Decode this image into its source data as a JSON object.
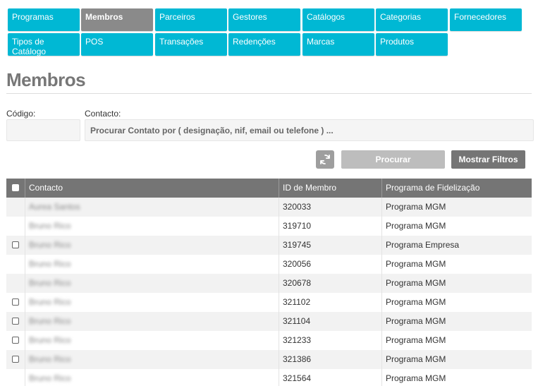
{
  "nav": {
    "row1": [
      "Programas",
      "Membros",
      "Parceiros",
      "Gestores",
      "Catálogos",
      "Categorias",
      "Fornecedores"
    ],
    "row2": [
      "Tipos de Catálogo",
      "POS",
      "Transações",
      "Redenções",
      "Marcas",
      "Produtos"
    ],
    "active": "Membros"
  },
  "page": {
    "title": "Membros"
  },
  "filters": {
    "code_label": "Código:",
    "code_value": "",
    "contact_label": "Contacto:",
    "contact_placeholder": "Procurar Contato por ( designação, nif, email ou telefone ) ..."
  },
  "actions": {
    "search_label": "Procurar",
    "show_filters_label": "Mostrar Filtros"
  },
  "table": {
    "headers": [
      "Contacto",
      "ID de Membro",
      "Programa de Fidelização"
    ],
    "rows": [
      {
        "contact": "Aurea Santos",
        "id": "320033",
        "program": "Programa MGM",
        "checkbox": false
      },
      {
        "contact": "Bruno Rico",
        "id": "319710",
        "program": "Programa MGM",
        "checkbox": false
      },
      {
        "contact": "Bruno Rico",
        "id": "319745",
        "program": "Programa Empresa",
        "checkbox": true
      },
      {
        "contact": "Bruno Rico",
        "id": "320056",
        "program": "Programa MGM",
        "checkbox": false
      },
      {
        "contact": "Bruno Rico",
        "id": "320678",
        "program": "Programa MGM",
        "checkbox": false
      },
      {
        "contact": "Bruno Rico",
        "id": "321102",
        "program": "Programa MGM",
        "checkbox": true
      },
      {
        "contact": "Bruno Rico",
        "id": "321104",
        "program": "Programa MGM",
        "checkbox": true
      },
      {
        "contact": "Bruno Rico",
        "id": "321233",
        "program": "Programa MGM",
        "checkbox": true
      },
      {
        "contact": "Bruno Rico",
        "id": "321386",
        "program": "Programa MGM",
        "checkbox": true
      },
      {
        "contact": "Bruno Rico",
        "id": "321564",
        "program": "Programa MGM",
        "checkbox": false
      }
    ]
  },
  "icons": {
    "refresh": "refresh-icon"
  },
  "colors": {
    "nav": "#00b8d4",
    "nav_active": "#8a8a8a",
    "header": "#757575"
  }
}
